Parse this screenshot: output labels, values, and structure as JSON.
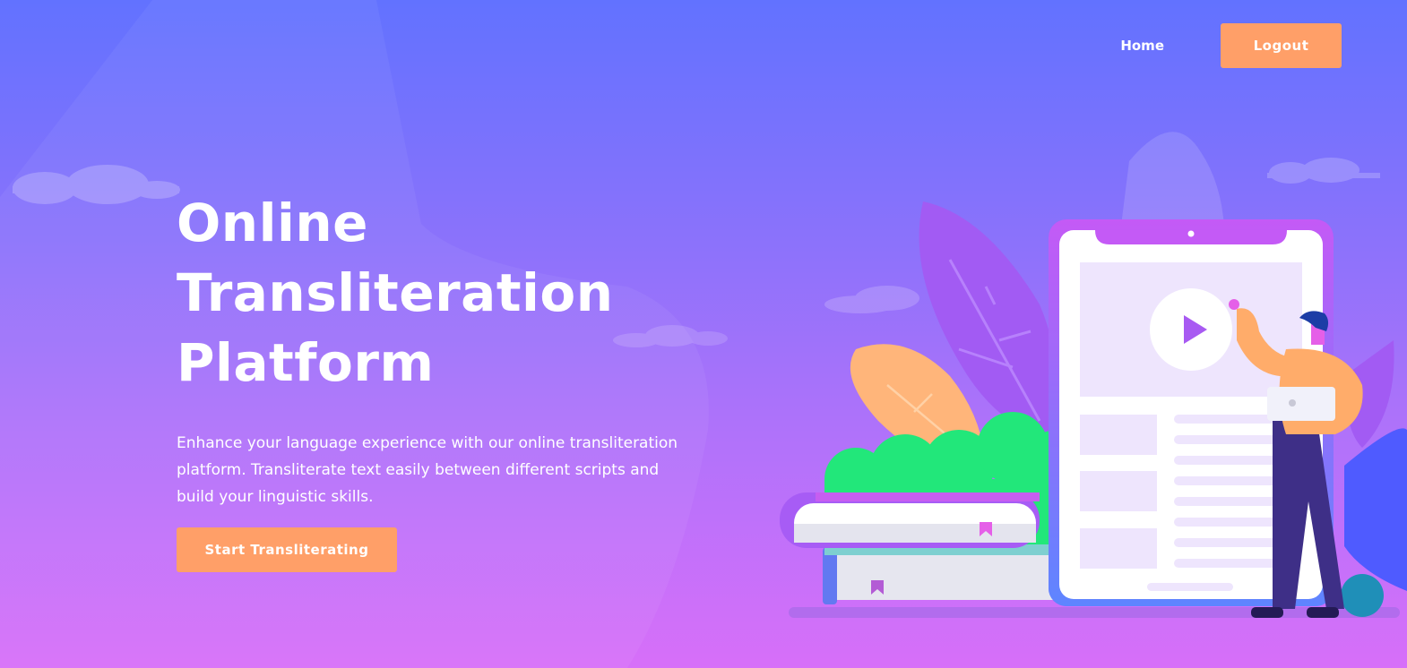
{
  "nav": {
    "home_label": "Home",
    "logout_label": "Logout"
  },
  "hero": {
    "title_line1": "Online",
    "title_line2": "Transliteration",
    "title_line3": "Platform",
    "description": "Enhance your language experience with our online transliteration platform. Transliterate text easily between different scripts and build your linguistic skills.",
    "cta_label": "Start Transliterating"
  },
  "colors": {
    "accent": "#ff9f68",
    "bg_top": "#6272ff",
    "bg_bottom": "#d76ff9"
  },
  "icons": {
    "illustration": "person-with-tablet-and-books-illustration",
    "play": "play-icon",
    "bookmark": "bookmark-icon"
  }
}
